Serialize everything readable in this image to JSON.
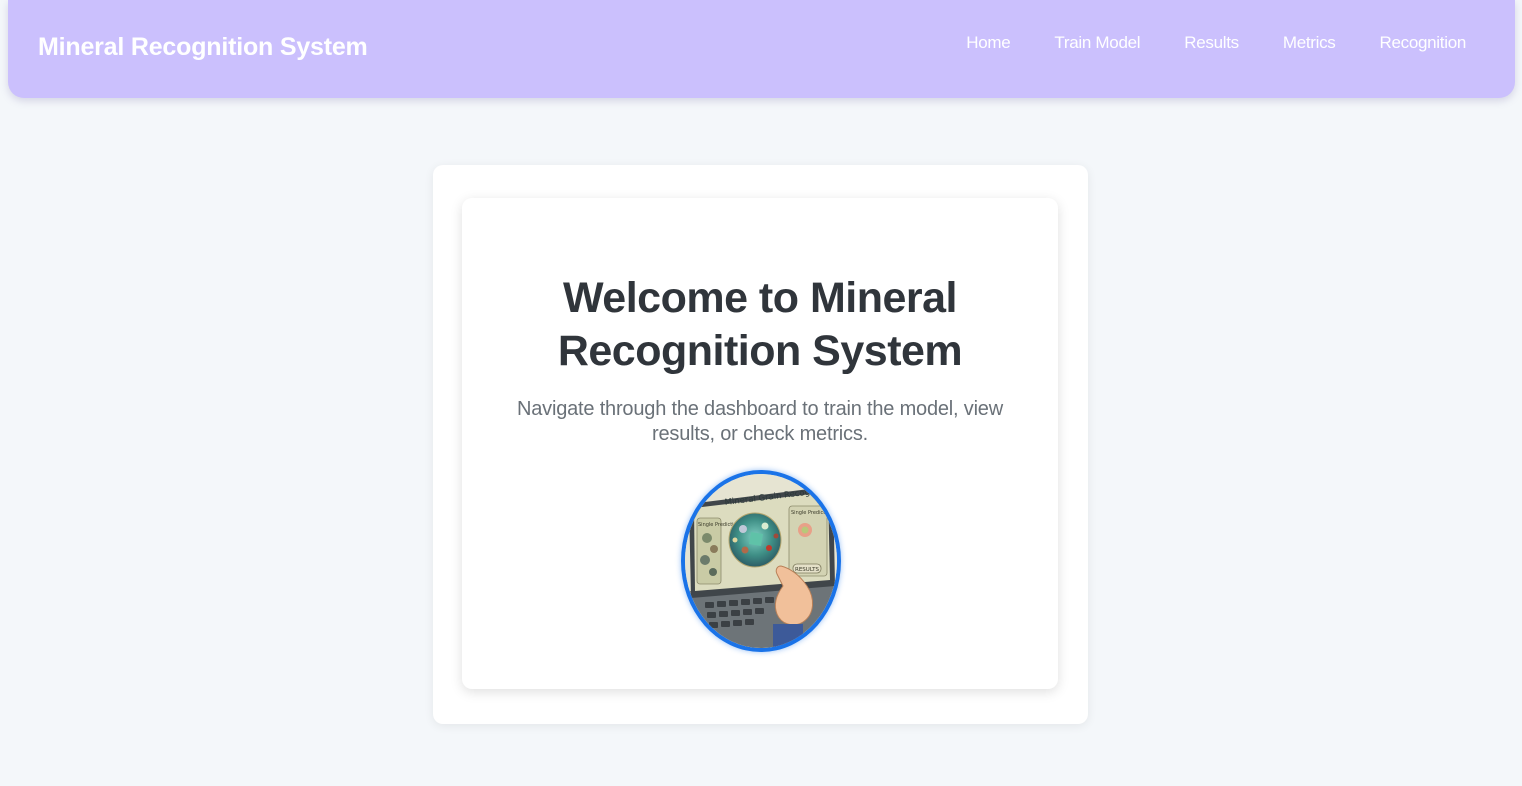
{
  "navbar": {
    "brand": "Mineral Recognition System",
    "links": [
      {
        "label": "Home"
      },
      {
        "label": "Train Model"
      },
      {
        "label": "Results"
      },
      {
        "label": "Metrics"
      },
      {
        "label": "Recognition"
      }
    ]
  },
  "hero": {
    "title": "Welcome to Mineral Recognition System",
    "subtitle": "Navigate through the dashboard to train the model, view results, or check metrics.",
    "image": {
      "screen_title": "Mineral Grain Recogni",
      "left_label": "Single Prediction",
      "right_label": "Single Prediction",
      "button_label": "RESULTS"
    }
  },
  "colors": {
    "navbar_bg": "#cbc0fd",
    "page_bg": "#f4f7fa",
    "title_text": "#30353b",
    "subtitle_text": "#6a7178",
    "image_border": "#1a73e8"
  }
}
